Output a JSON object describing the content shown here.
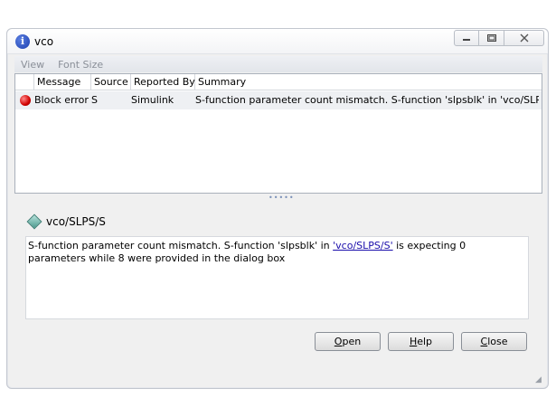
{
  "window": {
    "title": "vco",
    "icon": "info-icon"
  },
  "controls": {
    "minimize": "minimize-icon",
    "maximize": "maximize-icon",
    "close": "close-icon"
  },
  "menu": {
    "items": [
      "View",
      "Font Size"
    ]
  },
  "table": {
    "columns": [
      "Message",
      "Source",
      "Reported By",
      "Summary"
    ],
    "rows": [
      {
        "status_icon": "error-icon",
        "message": "Block error",
        "source": "S",
        "reported_by": "Simulink",
        "summary": "S-function parameter count mismatch.  S-function 'slpsblk' in 'vco/SLPS/S' is e..."
      }
    ]
  },
  "detail": {
    "title": "vco/SLPS/S",
    "text_before": "S-function parameter count mismatch. S-function 'slpsblk' in ",
    "link": "'vco/SLPS/S'",
    "text_after": " is expecting 0 parameters while 8 were provided in the dialog box"
  },
  "buttons": {
    "open_first": "O",
    "open_rest": "pen",
    "help_first": "H",
    "help_rest": "elp",
    "close_first": "C",
    "close_rest": "lose"
  },
  "colors": {
    "link": "#1a0dab",
    "error": "#d10000",
    "menu_text_disabled": "#8a8f98"
  }
}
